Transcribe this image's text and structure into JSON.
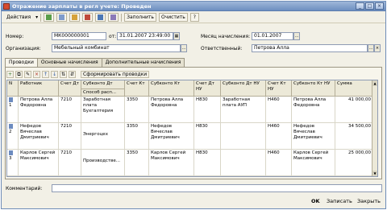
{
  "window": {
    "title": "Отражение зарплаты в регл учете: Проведен",
    "controls": [
      "_",
      "□",
      "×"
    ]
  },
  "toolbar": {
    "actions_label": "Действия",
    "fill_label": "Заполнить",
    "clear_label": "Очистить"
  },
  "header": {
    "number_label": "Номер:",
    "number_value": "МК000000001",
    "from_label": "от:",
    "date_value": "31.01.2007 23:49:00",
    "period_label": "Месяц начисления:",
    "period_value": "01.01.2007",
    "org_label": "Организация:",
    "org_value": "Мебельный комбинат",
    "resp_label": "Ответственный:",
    "resp_value": "Петрова Алла"
  },
  "tabs": [
    {
      "label": "Проводки",
      "active": true
    },
    {
      "label": "Основные начисления",
      "active": false
    },
    {
      "label": "Дополнительные начисления",
      "active": false
    }
  ],
  "grid_toolbar": {
    "generate_label": "Сформировать проводки"
  },
  "grid": {
    "headers": {
      "n": "N",
      "worker": "Работник",
      "acc_dt": "Счет Дт",
      "subconto_dt": "Субконто Дт",
      "method": "Способ расп...",
      "acc_kt": "Счет Кт",
      "subconto_kt": "Субконто Кт",
      "acc_dt_nu": "Счет Дт НУ",
      "subconto_dt_nu": "Субконто Дт НУ",
      "acc_kt_nu": "Счет Кт НУ",
      "subconto_kt_nu": "Субконто Кт НУ",
      "sum": "Сумма"
    },
    "rows": [
      {
        "n": "1",
        "worker": "Петрова Алла Федоровна",
        "acc_dt": "7210",
        "subconto_dt": "Заработная плата",
        "subconto_dt_2": "Бухгалтерия",
        "acc_kt": "3350",
        "subconto_kt": "Петрова Алла Федоровна",
        "acc_dt_nu": "Н830",
        "subconto_dt_nu": "Заработная плата АУП",
        "acc_kt_nu": "Н460",
        "subconto_kt_nu": "Петрова Алла Федоровна",
        "sum": "41 000,00"
      },
      {
        "n": "2",
        "worker": "Нефедов Вячеслав Дмитриевич",
        "acc_dt": "7210",
        "subconto_dt": "",
        "subconto_dt_2": "Энергоцех",
        "acc_kt": "3350",
        "subconto_kt": "Нефедов Вячеслав Дмитриевич",
        "acc_dt_nu": "Н830",
        "subconto_dt_nu": "",
        "acc_kt_nu": "Н460",
        "subconto_kt_nu": "Нефедов Вячеслав Дмитриевич",
        "sum": "34 500,00"
      },
      {
        "n": "3",
        "worker": "Карлов Сергей Максимович",
        "acc_dt": "7210",
        "subconto_dt": "",
        "subconto_dt_2": "Производстве...",
        "acc_kt": "3350",
        "subconto_kt": "Карлов Сергей Максимович",
        "acc_dt_nu": "Н830",
        "subconto_dt_nu": "",
        "acc_kt_nu": "Н460",
        "subconto_kt_nu": "Карлов Сергей Максимович",
        "sum": "25 000,00"
      }
    ]
  },
  "footer": {
    "comment_label": "Комментарий:",
    "comment_value": "",
    "ok_label": "OK",
    "save_label": "Записать",
    "close_label": "Закрыть"
  },
  "colors": {
    "title_bar": "#7c9ac9",
    "panel": "#f2f0e6",
    "grid_header": "#ece9d8"
  }
}
